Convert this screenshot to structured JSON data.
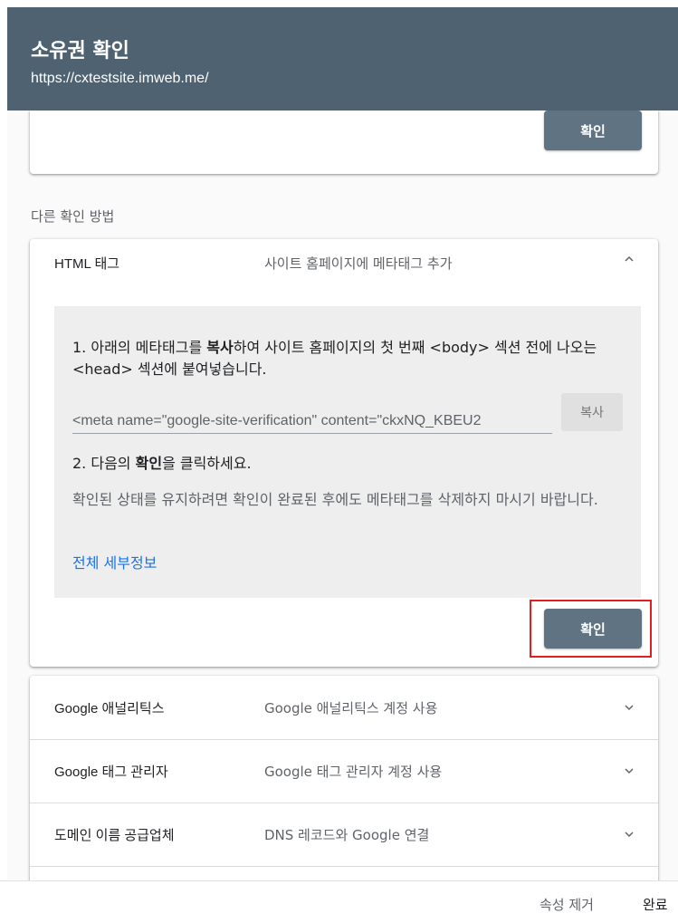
{
  "header": {
    "title": "소유권 확인",
    "url": "https://cxtestsite.imweb.me/"
  },
  "top_card": {
    "verify_label": "확인"
  },
  "other_methods_label": "다른 확인 방법",
  "html_tag": {
    "name": "HTML 태그",
    "description": "사이트 홈페이지에 메타태그 추가",
    "step1_prefix": "1. 아래의 메타태그를 ",
    "step1_bold": "복사",
    "step1_suffix": "하여 사이트 홈페이지의 첫 번째 <body> 섹션 전에 나오는 <head> 섹션에 붙여넣습니다.",
    "meta_value": "<meta name=\"google-site-verification\" content=\"ckxNQ_KBEU2",
    "copy_label": "복사",
    "step2_prefix": "2. 다음의 ",
    "step2_bold": "확인",
    "step2_suffix": "을 클릭하세요.",
    "note": "확인된 상태를 유지하려면 확인이 완료된 후에도 메타태그를 삭제하지 마시기 바랍니다.",
    "details_link": "전체 세부정보",
    "verify_label": "확인"
  },
  "methods": [
    {
      "name": "Google 애널리틱스",
      "description": "Google 애널리틱스 계정 사용"
    },
    {
      "name": "Google 태그 관리자",
      "description": "Google 태그 관리자 계정 사용"
    },
    {
      "name": "도메인 이름 공급업체",
      "description": "DNS 레코드와 Google 연결"
    }
  ],
  "footer": {
    "remove_label": "속성 제거",
    "done_label": "완료"
  },
  "colors": {
    "header_bg": "#4e6272",
    "button_bg": "#5f7382",
    "link": "#1a73e8",
    "highlight": "#e31e1e"
  },
  "icons": {
    "expanded": "chevron-up-icon",
    "collapsed": "chevron-down-icon"
  }
}
